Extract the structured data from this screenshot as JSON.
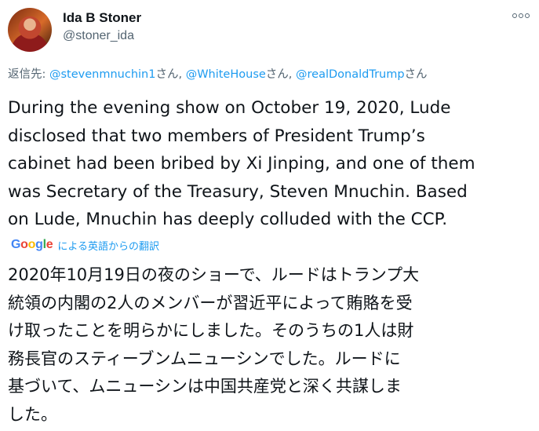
{
  "author": {
    "display_name": "Ida B Stoner",
    "handle": "@stoner_ida"
  },
  "more_icon": "more-horizontal-icon",
  "reply": {
    "prefix": "返信先: ",
    "mentions": [
      {
        "handle": "@stevenmnuchin1",
        "suffix": "さん, "
      },
      {
        "handle": "@WhiteHouse",
        "suffix": "さん, "
      },
      {
        "handle": "@realDonaldTrump",
        "suffix": "さん"
      }
    ]
  },
  "tweet_lines": [
    "During the evening show on October 19, 2020, Lude",
    "disclosed that two members of President Trump’s",
    "cabinet had been bribed by Xi Jinping, and one of them",
    "was Secretary of the Treasury, Steven Mnuchin. Based",
    "on Lude, Mnuchin has deeply colluded with the CCP."
  ],
  "translation_credit": {
    "logo_letters": [
      "G",
      "o",
      "o",
      "g",
      "l",
      "e"
    ],
    "text": "による英語からの翻訳"
  },
  "translation_lines": [
    "2020年10月19日の夜のショーで、ルードはトランプ大",
    "統領の内閣の2人のメンバーが習近平によって賄賂を受",
    "け取ったことを明らかにしました。そのうちの1人は財",
    "務長官のスティーブンムニューシンでした。ルードに",
    "基づいて、ムニューシンは中国共産党と深く共謀しま",
    "した。"
  ],
  "colors": {
    "text": "#0f1419",
    "secondary": "#536471",
    "link": "#1d9bf0"
  }
}
